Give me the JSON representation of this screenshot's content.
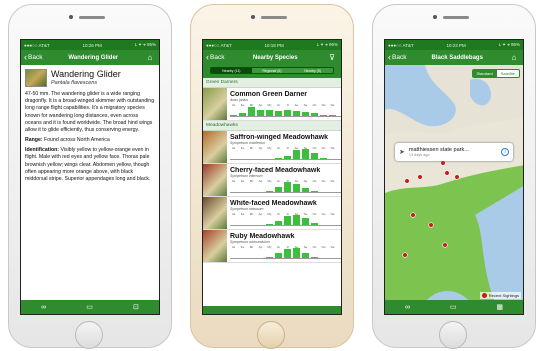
{
  "phone1": {
    "status": {
      "carrier": "●●●○○ AT&T",
      "time": "10:26 PM",
      "battery": "L ✦ ⌖ 95%"
    },
    "nav": {
      "back": "Back",
      "title": "Wandering Glider",
      "right_icon": "home-icon"
    },
    "species": {
      "common": "Wandering Glider",
      "scientific": "Pantala flavescens"
    },
    "paragraph1": "47-50 mm. The wandering glider is a wide ranging dragonfly. It is a broad-winged skimmer with outstanding long range flight capabilities. It's a migratory species known for wandering long distances, even across oceans and it is found worldwide. The broad hind wings allow it to glide efficiently, thus conserving energy.",
    "range_label": "Range:",
    "range_text": "Found across North America",
    "ident_label": "Identification:",
    "ident_text": "Visibly yellow to yellow-orange even in flight. Male with red eyes and yellow face. Thorax pale brownish yellow; wings clear. Abdomen yellow, though often appearing more orange above, with black middorsal stripe. Superior appendages long and black.",
    "toolbar_icons": [
      "link-icon",
      "image-icon",
      "expand-icon"
    ]
  },
  "phone2": {
    "status": {
      "carrier": "●●●○○ AT&T",
      "time": "10:18 PM",
      "battery": "L ✦ ⌖ 96%"
    },
    "nav": {
      "back": "Back",
      "title": "Nearby Species",
      "right_icon": "filter-icon"
    },
    "segments": [
      "Nearby (11)",
      "Regional (6)",
      "Nearby (5)"
    ],
    "months": [
      "Ja",
      "Fe",
      "Mr",
      "Ap",
      "My",
      "Jn",
      "Jl",
      "Au",
      "Se",
      "Oc",
      "No",
      "De"
    ],
    "sections": [
      {
        "header": "Green Darners",
        "species": [
          {
            "name": "Common Green Darner",
            "sci": "Anax junius",
            "bars": [
              0.1,
              0.3,
              0.9,
              0.6,
              0.6,
              0.5,
              0.6,
              0.5,
              0.4,
              0.3,
              0.1,
              0.05
            ],
            "thumb": "#8a9a4a"
          }
        ]
      },
      {
        "header": "Meadowhawks",
        "species": [
          {
            "name": "Saffron-winged Meadowhawk",
            "sci": "Sympetrum costiferum",
            "bars": [
              0,
              0,
              0,
              0,
              0,
              0.05,
              0.3,
              0.9,
              1,
              0.6,
              0.1,
              0
            ],
            "thumb": "#b46a2a"
          },
          {
            "name": "Cherry-faced Meadowhawk",
            "sci": "Sympetrum internum",
            "bars": [
              0,
              0,
              0,
              0,
              0.05,
              0.5,
              1,
              0.8,
              0.4,
              0.1,
              0,
              0
            ],
            "thumb": "#9c3a2a"
          },
          {
            "name": "White-faced Meadowhawk",
            "sci": "Sympetrum obtrusum",
            "bars": [
              0,
              0,
              0,
              0,
              0.05,
              0.4,
              0.9,
              1,
              0.7,
              0.2,
              0,
              0
            ],
            "thumb": "#6a4a30"
          },
          {
            "name": "Ruby Meadowhawk",
            "sci": "Sympetrum rubicundulum",
            "bars": [
              0,
              0,
              0,
              0,
              0.05,
              0.5,
              0.9,
              1,
              0.5,
              0.1,
              0,
              0
            ],
            "thumb": "#a8402a"
          }
        ]
      }
    ]
  },
  "phone3": {
    "status": {
      "carrier": "●●●○○ AT&T",
      "time": "10:23 PM",
      "battery": "L ✦ ⌖ 95%"
    },
    "nav": {
      "back": "Back",
      "title": "Black Saddlebags",
      "right_icon": "home-icon"
    },
    "map_segments": [
      "Standard",
      "Satellite"
    ],
    "callout": {
      "title": "matthiessen state park...",
      "subtitle": "13 days ago"
    },
    "legend": "Recent Sightings",
    "colors": {
      "sighting": "#cc1a1a",
      "land_north": "#e6e3d6",
      "land_south": "#7cc44f",
      "water": "#aacbe8"
    }
  }
}
